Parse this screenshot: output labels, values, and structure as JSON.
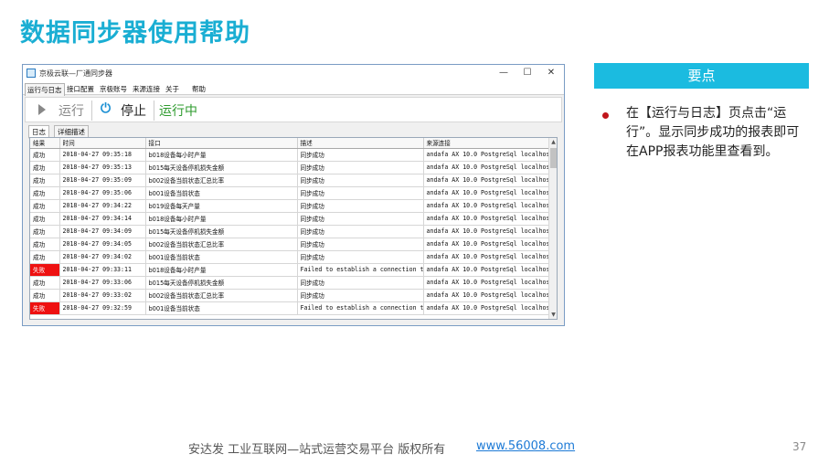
{
  "slide": {
    "title": "数据同步器使用帮助",
    "panel_title": "要点",
    "bullet_text": "在【运行与日志】页点击“运行”。显示同步成功的报表即可在APP报表功能里查看到。",
    "footer_text": "安达发   工业互联网—站式运营交易平台   版权所有",
    "footer_link": "www.56008.com",
    "page_number": "37",
    "colors": {
      "title": "#1aaed3",
      "panel": "#1bbbe0",
      "bullet": "#c0151b",
      "fail": "#ee1111"
    }
  },
  "window": {
    "title": "京极云联—厂通同步器",
    "controls": {
      "minimize": "—",
      "maximize": "☐",
      "close": "✕"
    },
    "menu": [
      "运行与日志",
      "接口配置",
      "京极账号",
      "来源连接",
      "关于",
      "帮助"
    ],
    "toolbar": {
      "run_label": "运行",
      "stop_label": "停止",
      "status": "运行中"
    },
    "subtabs": [
      "日志",
      "详细描述"
    ],
    "grid": {
      "columns": [
        "结果",
        "时间",
        "接口",
        "描述",
        "来源连接"
      ],
      "rows": [
        {
          "result": "成功",
          "time": "2018-04-27 09:35:18",
          "iface": "b018设备每小时产量",
          "desc": "同步成功",
          "source": "andafa AX 10.0 PostgreSql localhos..."
        },
        {
          "result": "成功",
          "time": "2018-04-27 09:35:13",
          "iface": "b015每天设备停机损失金额",
          "desc": "同步成功",
          "source": "andafa AX 10.0 PostgreSql localhos..."
        },
        {
          "result": "成功",
          "time": "2018-04-27 09:35:09",
          "iface": "b002设备当前状态汇总比率",
          "desc": "同步成功",
          "source": "andafa AX 10.0 PostgreSql localhos..."
        },
        {
          "result": "成功",
          "time": "2018-04-27 09:35:06",
          "iface": "b001设备当前状态",
          "desc": "同步成功",
          "source": "andafa AX 10.0 PostgreSql localhos..."
        },
        {
          "result": "成功",
          "time": "2018-04-27 09:34:22",
          "iface": "b019设备每天产量",
          "desc": "同步成功",
          "source": "andafa AX 10.0 PostgreSql localhos..."
        },
        {
          "result": "成功",
          "time": "2018-04-27 09:34:14",
          "iface": "b018设备每小时产量",
          "desc": "同步成功",
          "source": "andafa AX 10.0 PostgreSql localhos..."
        },
        {
          "result": "成功",
          "time": "2018-04-27 09:34:09",
          "iface": "b015每天设备停机损失金额",
          "desc": "同步成功",
          "source": "andafa AX 10.0 PostgreSql localhos..."
        },
        {
          "result": "成功",
          "time": "2018-04-27 09:34:05",
          "iface": "b002设备当前状态汇总比率",
          "desc": "同步成功",
          "source": "andafa AX 10.0 PostgreSql localhos..."
        },
        {
          "result": "成功",
          "time": "2018-04-27 09:34:02",
          "iface": "b001设备当前状态",
          "desc": "同步成功",
          "source": "andafa AX 10.0 PostgreSql localhos..."
        },
        {
          "result": "失败",
          "time": "2018-04-27 09:33:11",
          "iface": "b018设备每小时产量",
          "desc": "Failed to establish a connection t...",
          "source": "andafa AX 10.0 PostgreSql localhos..."
        },
        {
          "result": "成功",
          "time": "2018-04-27 09:33:06",
          "iface": "b015每天设备停机损失金额",
          "desc": "同步成功",
          "source": "andafa AX 10.0 PostgreSql localhos..."
        },
        {
          "result": "成功",
          "time": "2018-04-27 09:33:02",
          "iface": "b002设备当前状态汇总比率",
          "desc": "同步成功",
          "source": "andafa AX 10.0 PostgreSql localhos..."
        },
        {
          "result": "失败",
          "time": "2018-04-27 09:32:59",
          "iface": "b001设备当前状态",
          "desc": "Failed to establish a connection t...",
          "source": "andafa AX 10.0 PostgreSql localhos..."
        }
      ]
    }
  }
}
